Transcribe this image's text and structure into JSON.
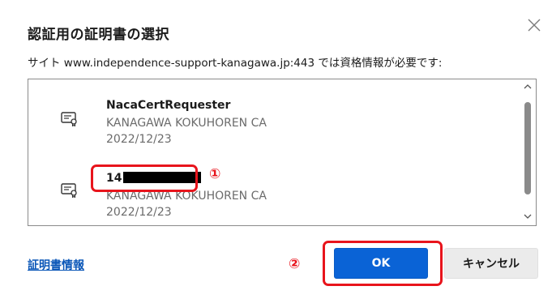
{
  "dialog": {
    "title": "認証用の証明書の選択",
    "subtitle": "サイト www.independence-support-kanagawa.jp:443 では資格情報が必要です:",
    "close_icon": "close-icon"
  },
  "certificates": [
    {
      "name": "NacaCertRequester",
      "issuer": "KANAGAWA KOKUHOREN CA",
      "date": "2022/12/23",
      "icon": "certificate-icon"
    },
    {
      "name_prefix": "14",
      "name_redacted": true,
      "issuer": "KANAGAWA KOKUHOREN CA",
      "date": "2022/12/23",
      "icon": "certificate-icon"
    }
  ],
  "footer": {
    "cert_info_link": "証明書情報",
    "ok_label": "OK",
    "cancel_label": "キャンセル"
  },
  "annotations": {
    "marker_1": "①",
    "marker_2": "②",
    "color": "#e8141c"
  },
  "colors": {
    "accent": "#0a63d6",
    "link": "#0b57b8"
  }
}
